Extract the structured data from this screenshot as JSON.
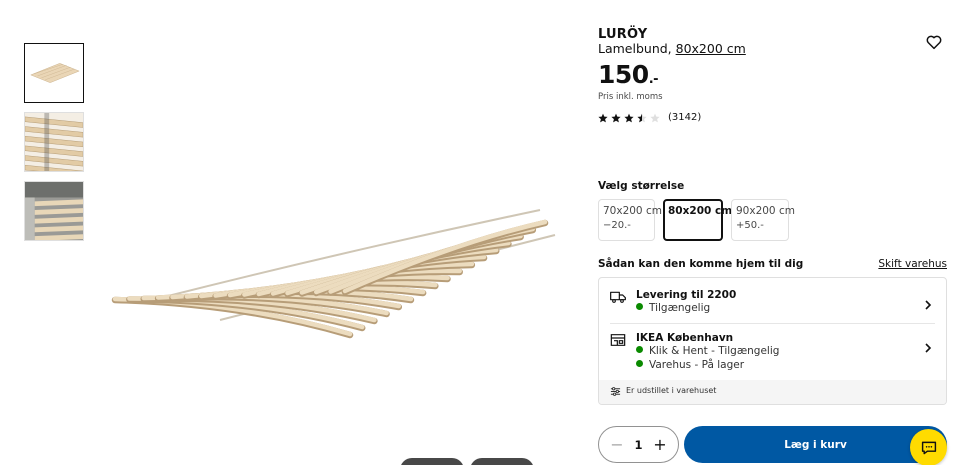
{
  "thumbnails": [
    {
      "name": "thumb-slatted-base-full",
      "active": true
    },
    {
      "name": "thumb-slatted-base-closeup",
      "active": false
    },
    {
      "name": "thumb-slatted-base-in-bed",
      "active": false
    }
  ],
  "product": {
    "name": "LURÖY",
    "description": "Lamelbund, ",
    "size_link": "80x200 cm",
    "price": "150",
    "price_suffix": ".-",
    "price_note": "Pris inkl. moms",
    "rating_stars": 3.5,
    "rating_count": "(3142)"
  },
  "sizes": {
    "heading": "Vælg størrelse",
    "options": [
      {
        "label": "70x200 cm",
        "price": "−20.-",
        "selected": false
      },
      {
        "label": "80x200 cm",
        "price": "",
        "selected": true
      },
      {
        "label": "90x200 cm",
        "price": "+50.-",
        "selected": false
      }
    ]
  },
  "availability": {
    "heading": "Sådan kan den komme hjem til dig",
    "change_store": "Skift varehus",
    "delivery": {
      "title": "Levering til 2200",
      "status": "Tilgængelig"
    },
    "store": {
      "title": "IKEA København",
      "status_1": "Klik & Hent - Tilgængelig",
      "status_2": "Varehus - På lager"
    },
    "footer": "Er udstillet i varehuset"
  },
  "cart": {
    "quantity": "1",
    "add_label": "Læg i kurv"
  },
  "colors": {
    "primary_blue": "#0058a3",
    "available_green": "#0a8a00",
    "chat_yellow": "#ffdb00"
  },
  "icons": [
    "heart-icon",
    "star-icon",
    "truck-icon",
    "store-icon",
    "chevron-right-icon",
    "filter-icon",
    "minus-icon",
    "plus-icon",
    "chat-icon"
  ]
}
